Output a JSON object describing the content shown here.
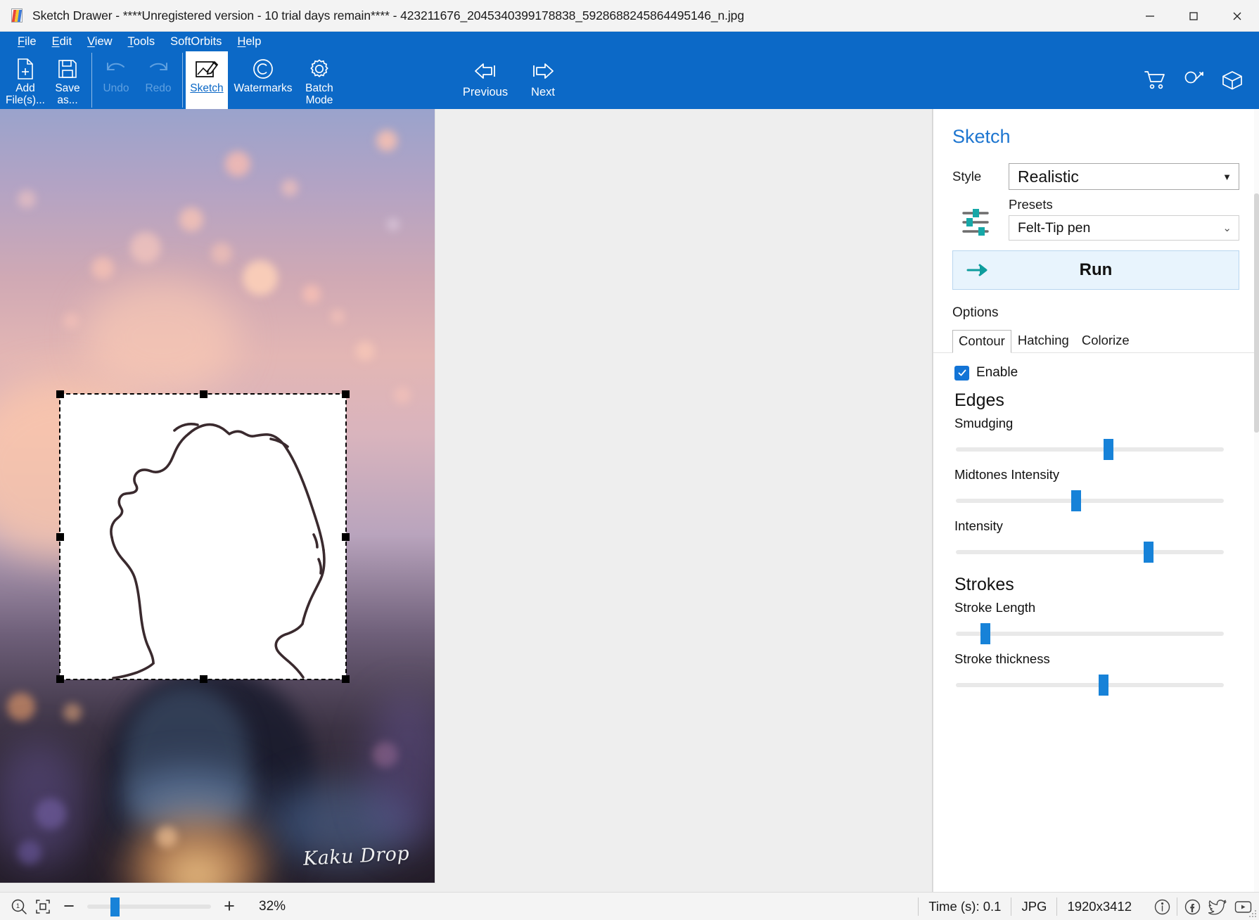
{
  "window": {
    "title": "Sketch Drawer - ****Unregistered version - 10 trial days remain**** - 423211676_2045340399178838_5928688245864495146_n.jpg",
    "minimize": "minimize-icon",
    "maximize": "maximize-icon",
    "close": "close-icon"
  },
  "menubar": {
    "items": [
      {
        "label": "File",
        "accel": "F"
      },
      {
        "label": "Edit",
        "accel": "E"
      },
      {
        "label": "View",
        "accel": "V"
      },
      {
        "label": "Tools",
        "accel": "T"
      },
      {
        "label": "SoftOrbits",
        "accel": ""
      },
      {
        "label": "Help",
        "accel": "H"
      }
    ]
  },
  "toolbar": {
    "add_files": "Add\nFile(s)...",
    "add_files_l1": "Add",
    "add_files_l2": "File(s)...",
    "save_as_l1": "Save",
    "save_as_l2": "as...",
    "undo": "Undo",
    "redo": "Redo",
    "sketch": "Sketch",
    "watermarks": "Watermarks",
    "batch_l1": "Batch",
    "batch_l2": "Mode",
    "previous": "Previous",
    "next": "Next",
    "right_icons": [
      "cart-icon",
      "key-icon",
      "box-icon"
    ]
  },
  "canvas": {
    "watermark": "Kaku Drop"
  },
  "panel": {
    "title": "Sketch",
    "style_label": "Style",
    "style_value": "Realistic",
    "presets_label": "Presets",
    "presets_value": "Felt-Tip pen",
    "run_label": "Run",
    "options_label": "Options",
    "tabs": [
      {
        "label": "Contour",
        "active": true
      },
      {
        "label": "Hatching",
        "active": false
      },
      {
        "label": "Colorize",
        "active": false
      }
    ],
    "enable_label": "Enable",
    "enable_checked": true,
    "sections": [
      {
        "heading": "Edges",
        "sliders": [
          {
            "label": "Smudging",
            "percent": 57
          },
          {
            "label": "Midtones Intensity",
            "percent": 45
          },
          {
            "label": "Intensity",
            "percent": 72
          }
        ]
      },
      {
        "heading": "Strokes",
        "sliders": [
          {
            "label": "Stroke Length",
            "percent": 11
          },
          {
            "label": "Stroke thickness",
            "percent": 55
          }
        ]
      }
    ]
  },
  "statusbar": {
    "zoom_icon": "zoom-1to1-icon",
    "fit_icon": "fit-to-window-icon",
    "minus": "−",
    "plus": "+",
    "zoom_percent": "32%",
    "zoom_slider_percent": 19,
    "time": "Time (s): 0.1",
    "format": "JPG",
    "dimensions": "1920x3412",
    "social_icons": [
      "info-icon",
      "facebook-icon",
      "twitter-icon",
      "youtube-icon"
    ]
  },
  "colors": {
    "toolbar_blue": "#0c69c7",
    "accent_blue": "#1782d8",
    "panel_title_blue": "#1e76d0",
    "run_bg": "#e8f4fd",
    "teal": "#16a8a8"
  }
}
